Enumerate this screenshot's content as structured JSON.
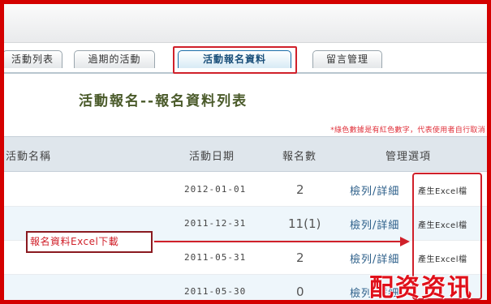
{
  "tabs": [
    {
      "label": "活動列表"
    },
    {
      "label": "過期的活動"
    },
    {
      "label": "活動報名資料"
    },
    {
      "label": "留言管理"
    }
  ],
  "page_title": "活動報名--報名資料列表",
  "note": "*綠色數據是有紅色數字，代表使用者自行取消",
  "table": {
    "headers": [
      "活動名稱",
      "活動日期",
      "報名數",
      "管理選項"
    ],
    "rows": [
      {
        "date": "2012-01-01",
        "count": "2",
        "action": "檢列/詳細",
        "excel": "產生Excel檔"
      },
      {
        "date": "2011-12-31",
        "count": "11(1)",
        "action": "檢列/詳細",
        "excel": "產生Excel檔"
      },
      {
        "date": "2011-05-31",
        "count": "2",
        "action": "檢列/詳細",
        "excel": "產生Excel檔"
      },
      {
        "date": "2011-05-30",
        "count": "0",
        "action": "檢列/詳細",
        "excel": ""
      }
    ]
  },
  "callout": "報名資料Excel下載",
  "watermark": "配资资讯",
  "colors": {
    "highlight": "#d0202a",
    "header_bg": "#dfe6ec",
    "alt_row": "#eef6fb"
  }
}
